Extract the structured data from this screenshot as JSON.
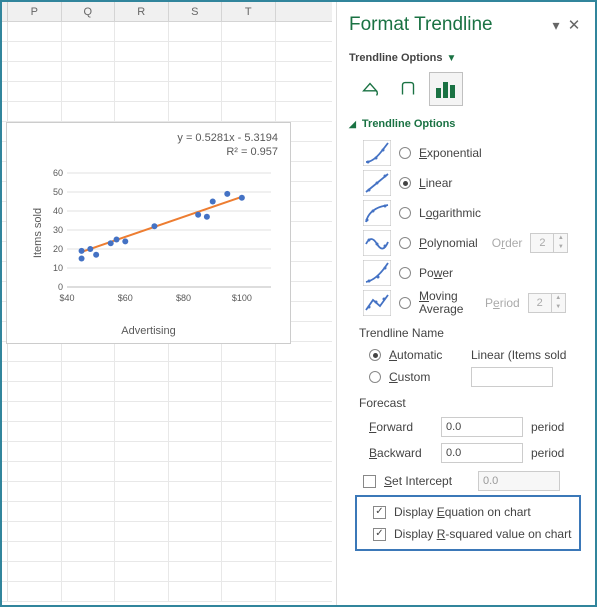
{
  "columns": [
    "P",
    "Q",
    "R",
    "S",
    "T"
  ],
  "pane": {
    "title": "Format Trendline",
    "section": "Trendline Options",
    "sub": "Trendline Options",
    "types": {
      "exponential": "Exponential",
      "linear": "Linear",
      "logarithmic": "Logarithmic",
      "polynomial": "Polynomial",
      "power": "Power",
      "moving": "Moving Average",
      "order_label": "Order",
      "order_value": "2",
      "period_label": "Period",
      "period_value": "2"
    },
    "name": {
      "head": "Trendline Name",
      "auto": "Automatic",
      "custom": "Custom",
      "auto_value": "Linear (Items sold"
    },
    "forecast": {
      "head": "Forecast",
      "forward": "Forward",
      "backward": "Backward",
      "fval": "0.0",
      "bval": "0.0",
      "unit": "period"
    },
    "intercept": {
      "label": "Set Intercept",
      "value": "0.0"
    },
    "display_eq": "Display Equation on chart",
    "display_r2": "Display R-squared value on chart"
  },
  "chart": {
    "equation": "y = 0.5281x - 5.3194",
    "r2": "R² = 0.957",
    "y_label": "Items sold",
    "x_label": "Advertising",
    "y_ticks": [
      "0",
      "10",
      "20",
      "30",
      "40",
      "50",
      "60"
    ],
    "x_ticks": [
      "$40",
      "$60",
      "$80",
      "$100"
    ]
  },
  "chart_data": {
    "type": "scatter",
    "xlabel": "Advertising",
    "ylabel": "Items sold",
    "xlim": [
      40,
      110
    ],
    "ylim": [
      0,
      60
    ],
    "points": [
      {
        "x": 45,
        "y": 15
      },
      {
        "x": 45,
        "y": 19
      },
      {
        "x": 48,
        "y": 20
      },
      {
        "x": 50,
        "y": 17
      },
      {
        "x": 55,
        "y": 23
      },
      {
        "x": 57,
        "y": 25
      },
      {
        "x": 60,
        "y": 24
      },
      {
        "x": 70,
        "y": 32
      },
      {
        "x": 85,
        "y": 38
      },
      {
        "x": 88,
        "y": 37
      },
      {
        "x": 90,
        "y": 45
      },
      {
        "x": 95,
        "y": 49
      },
      {
        "x": 100,
        "y": 47
      }
    ],
    "trendline": {
      "slope": 0.5281,
      "intercept": -5.3194,
      "r2": 0.957,
      "xrange": [
        45,
        100
      ]
    }
  }
}
